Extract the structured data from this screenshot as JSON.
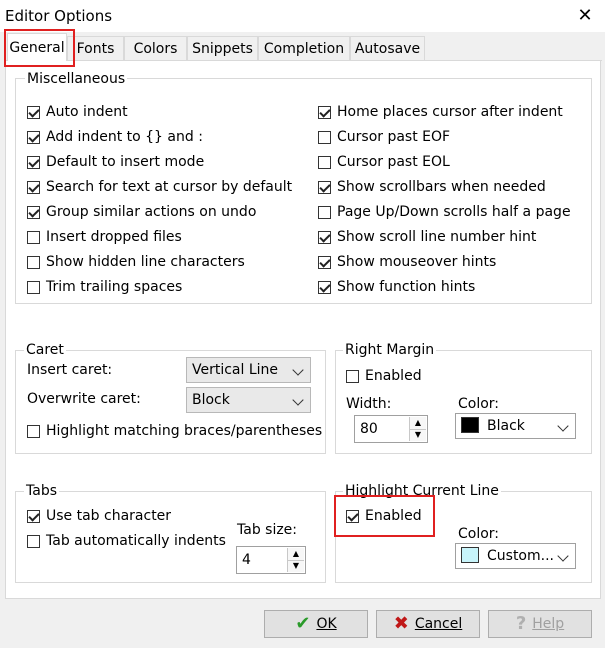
{
  "window": {
    "title": "Editor Options",
    "close_glyph": "✕"
  },
  "tabs": [
    {
      "label": "General",
      "active": true
    },
    {
      "label": "Fonts"
    },
    {
      "label": "Colors"
    },
    {
      "label": "Snippets"
    },
    {
      "label": "Completion"
    },
    {
      "label": "Autosave"
    }
  ],
  "misc": {
    "label": "Miscellaneous",
    "left": [
      {
        "label": "Auto indent",
        "checked": true
      },
      {
        "label": "Add indent to {} and :",
        "checked": true
      },
      {
        "label": "Default to insert mode",
        "checked": true
      },
      {
        "label": "Search for text at cursor by default",
        "checked": true
      },
      {
        "label": "Group similar actions on undo",
        "checked": true
      },
      {
        "label": "Insert dropped files",
        "checked": false
      },
      {
        "label": "Show hidden line characters",
        "checked": false
      },
      {
        "label": "Trim trailing spaces",
        "checked": false
      }
    ],
    "right": [
      {
        "label": "Home places cursor after indent",
        "checked": true
      },
      {
        "label": "Cursor past EOF",
        "checked": false
      },
      {
        "label": "Cursor past EOL",
        "checked": false
      },
      {
        "label": "Show scrollbars when needed",
        "checked": true
      },
      {
        "label": "Page Up/Down scrolls half a page",
        "checked": false
      },
      {
        "label": "Show scroll line number hint",
        "checked": true
      },
      {
        "label": "Show mouseover hints",
        "checked": true
      },
      {
        "label": "Show function hints",
        "checked": true
      }
    ]
  },
  "caret": {
    "label": "Caret",
    "insert_label": "Insert caret:",
    "insert_value": "Vertical Line",
    "overwrite_label": "Overwrite caret:",
    "overwrite_value": "Block",
    "highlight_braces": {
      "label": "Highlight matching braces/parentheses",
      "checked": false
    }
  },
  "right_margin": {
    "label": "Right Margin",
    "enabled": {
      "label": "Enabled",
      "checked": false
    },
    "width_label": "Width:",
    "width_value": "80",
    "color_label": "Color:",
    "color_value": "Black",
    "color_swatch": "#000000"
  },
  "tabs_group": {
    "label": "Tabs",
    "use_tab": {
      "label": "Use tab character",
      "checked": true
    },
    "auto_indent": {
      "label": "Tab automatically indents",
      "checked": false
    },
    "tab_size_label": "Tab size:",
    "tab_size_value": "4"
  },
  "highlight_line": {
    "label": "Highlight Current Line",
    "enabled": {
      "label": "Enabled",
      "checked": true
    },
    "color_label": "Color:",
    "color_value": "Custom...",
    "color_swatch": "#c8f4fa"
  },
  "buttons": {
    "ok": {
      "label": "OK",
      "icon": "check-icon",
      "glyph": "✔"
    },
    "cancel": {
      "label": "Cancel",
      "icon": "cross-icon",
      "glyph": "✖"
    },
    "help": {
      "label": "Help",
      "icon": "help-icon",
      "glyph": "?",
      "disabled": true
    }
  },
  "accent_colors": {
    "highlight_box": "#e02020",
    "ok_icon": "#2a9a2a",
    "cancel_icon": "#c01818"
  }
}
